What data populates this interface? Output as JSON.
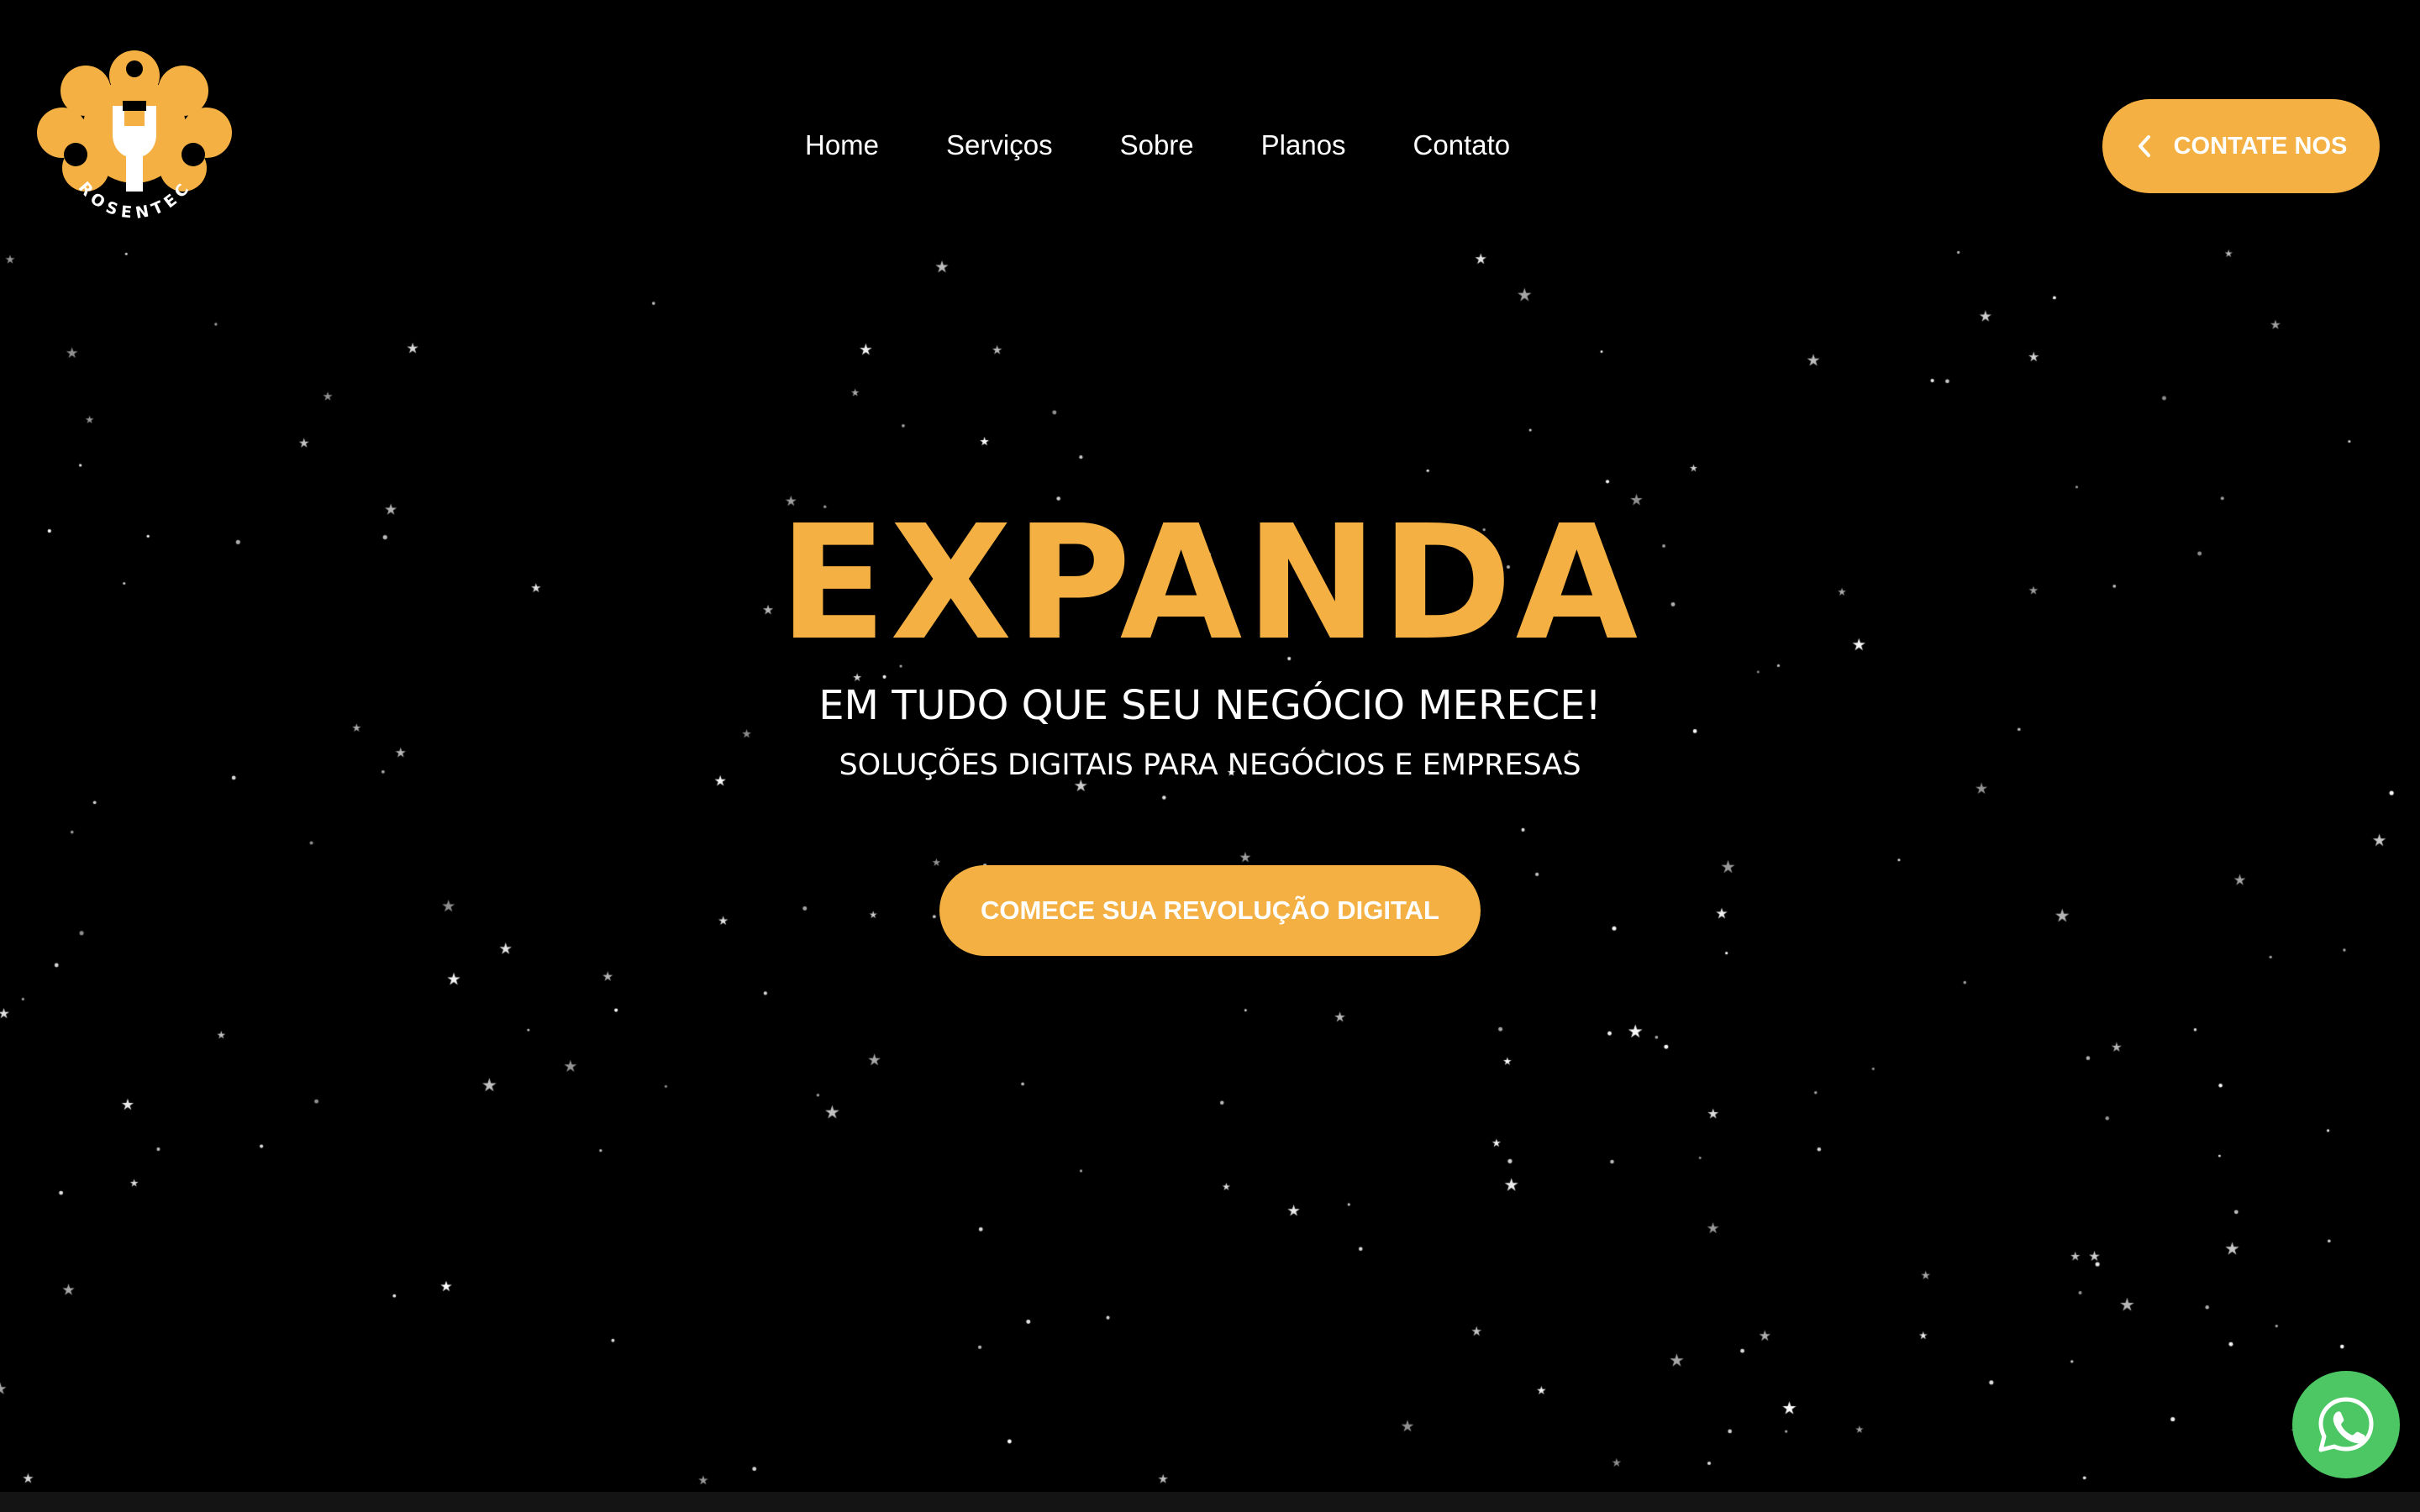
{
  "brand": {
    "logo_text": "ROSENTECH",
    "accent_color": "#f4b042",
    "background_color": "#000000",
    "whatsapp_color": "#4cc764"
  },
  "nav": {
    "items": [
      {
        "label": "Home"
      },
      {
        "label": "Serviços"
      },
      {
        "label": "Sobre"
      },
      {
        "label": "Planos"
      },
      {
        "label": "Contato"
      }
    ]
  },
  "header": {
    "contact_button_label": "CONTATE NOS",
    "contact_button_icon": "chevron-left-icon"
  },
  "hero": {
    "title": "EXPANDA",
    "subtitle": "EM TUDO QUE SEU NEGÓCIO MERECE!",
    "tagline": "SOLUÇÕES DIGITAIS PARA NEGÓCIOS E EMPRESAS",
    "cta_label": "COMECE SUA REVOLUÇÃO DIGITAL"
  },
  "floating": {
    "whatsapp_icon": "whatsapp-icon"
  },
  "background": {
    "decoration": "starfield"
  }
}
